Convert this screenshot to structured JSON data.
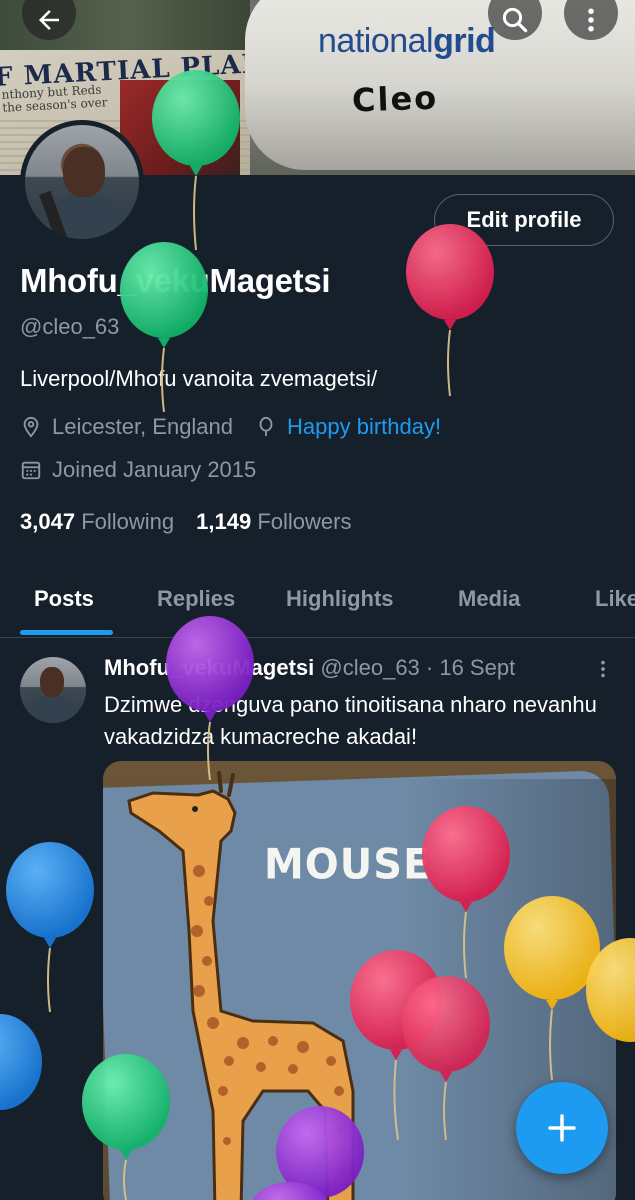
{
  "banner": {
    "newspaper_headline": "F MARTIAL PLAN AFT",
    "newspaper_subline_1": "nthony but Reds",
    "newspaper_subline_2": "the season's over",
    "brand_light": "national",
    "brand_bold": "grid",
    "handwritten_name": "Cleo"
  },
  "profile": {
    "display_name": "Mhofu_vekuMagetsi",
    "handle": "@cleo_63",
    "bio": "Liverpool/Mhofu vanoita zvemagetsi/",
    "location": "Leicester, England",
    "birthday": "Happy birthday!",
    "joined": "Joined January 2015",
    "following_count": "3,047",
    "following_label": "Following",
    "followers_count": "1,149",
    "followers_label": "Followers",
    "edit_label": "Edit profile"
  },
  "tabs": [
    {
      "label": "Posts",
      "active": true
    },
    {
      "label": "Replies"
    },
    {
      "label": "Highlights"
    },
    {
      "label": "Media"
    },
    {
      "label": "Likes"
    }
  ],
  "post": {
    "author": "Mhofu_vekuMagetsi",
    "meta": "@cleo_63 · 16 Sept",
    "text": "Dzimwe dzenguva pano tinoitisana nharo nevanhu vakadzidza kumacreche akadai!",
    "image_text": "MOUSE"
  },
  "icons": {
    "back": "arrow-left-icon",
    "search": "search-icon",
    "more": "more-vertical-icon",
    "location": "location-pin-icon",
    "birthday": "balloon-icon",
    "calendar": "calendar-icon",
    "compose": "plus-icon"
  },
  "colors": {
    "background": "#15202b",
    "accent": "#1d9bf0",
    "secondary_text": "#8b98a5",
    "divider": "#38444d"
  }
}
